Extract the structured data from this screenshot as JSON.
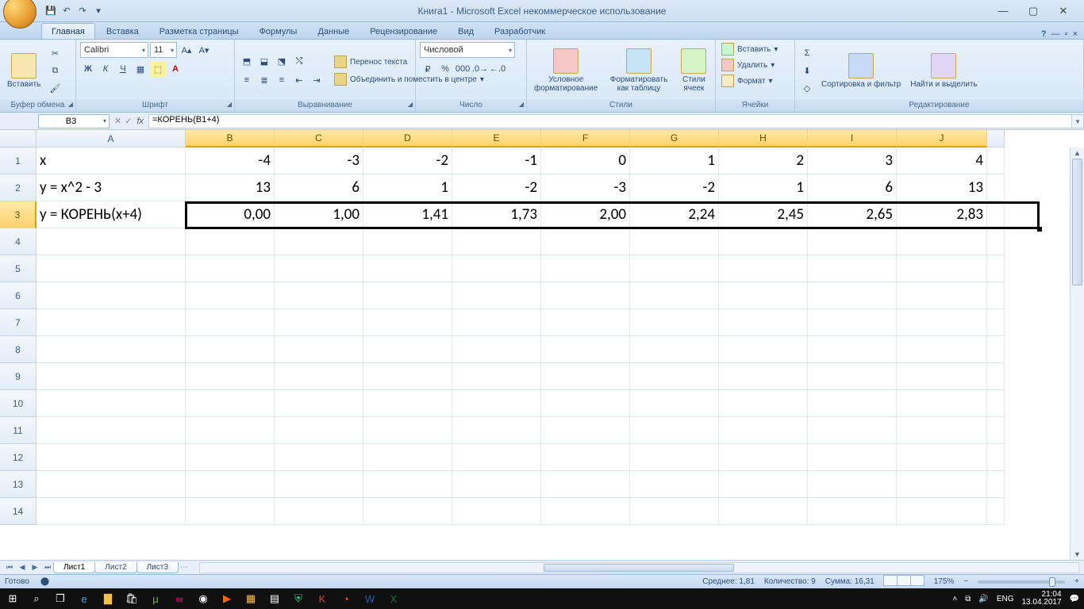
{
  "title": "Книга1 - Microsoft Excel некоммерческое использование",
  "tabs": [
    "Главная",
    "Вставка",
    "Разметка страницы",
    "Формулы",
    "Данные",
    "Рецензирование",
    "Вид",
    "Разработчик"
  ],
  "active_tab": 0,
  "ribbon": {
    "clipboard": {
      "paste": "Вставить",
      "label": "Буфер обмена"
    },
    "font": {
      "name": "Calibri",
      "size": "11",
      "label": "Шрифт"
    },
    "align": {
      "wrap": "Перенос текста",
      "merge": "Объединить и поместить в центре",
      "label": "Выравнивание"
    },
    "number": {
      "format": "Числовой",
      "label": "Число"
    },
    "styles": {
      "cond": "Условное форматирование",
      "table": "Форматировать как таблицу",
      "cell": "Стили ячеек",
      "label": "Стили"
    },
    "cells": {
      "insert": "Вставить",
      "delete": "Удалить",
      "format": "Формат",
      "label": "Ячейки"
    },
    "editing": {
      "sort": "Сортировка и фильтр",
      "find": "Найти и выделить",
      "label": "Редактирование"
    }
  },
  "namebox": "B3",
  "formula": "=КОРЕНЬ(B1+4)",
  "columns": [
    "A",
    "B",
    "C",
    "D",
    "E",
    "F",
    "G",
    "H",
    "I",
    "J"
  ],
  "row_numbers": [
    1,
    2,
    3,
    4,
    5,
    6,
    7,
    8,
    9,
    10,
    11,
    12,
    13,
    14
  ],
  "data": {
    "A1": "x",
    "B1": "-4",
    "C1": "-3",
    "D1": "-2",
    "E1": "-1",
    "F1": "0",
    "G1": "1",
    "H1": "2",
    "I1": "3",
    "J1": "4",
    "A2": "y = x^2 - 3",
    "B2": "13",
    "C2": "6",
    "D2": "1",
    "E2": "-2",
    "F2": "-3",
    "G2": "-2",
    "H2": "1",
    "I2": "6",
    "J2": "13",
    "A3": "y = КОРЕНЬ(x+4)",
    "B3": "0,00",
    "C3": "1,00",
    "D3": "1,41",
    "E3": "1,73",
    "F3": "2,00",
    "G3": "2,24",
    "H3": "2,45",
    "I3": "2,65",
    "J3": "2,83"
  },
  "sheets": [
    "Лист1",
    "Лист2",
    "Лист3"
  ],
  "active_sheet": 0,
  "status": {
    "ready": "Готово",
    "avg": "Среднее: 1,81",
    "count": "Количество: 9",
    "sum": "Сумма: 16,31",
    "zoom": "175%"
  },
  "tray": {
    "lang": "ENG",
    "time": "21:04",
    "date": "13.04.2017"
  }
}
